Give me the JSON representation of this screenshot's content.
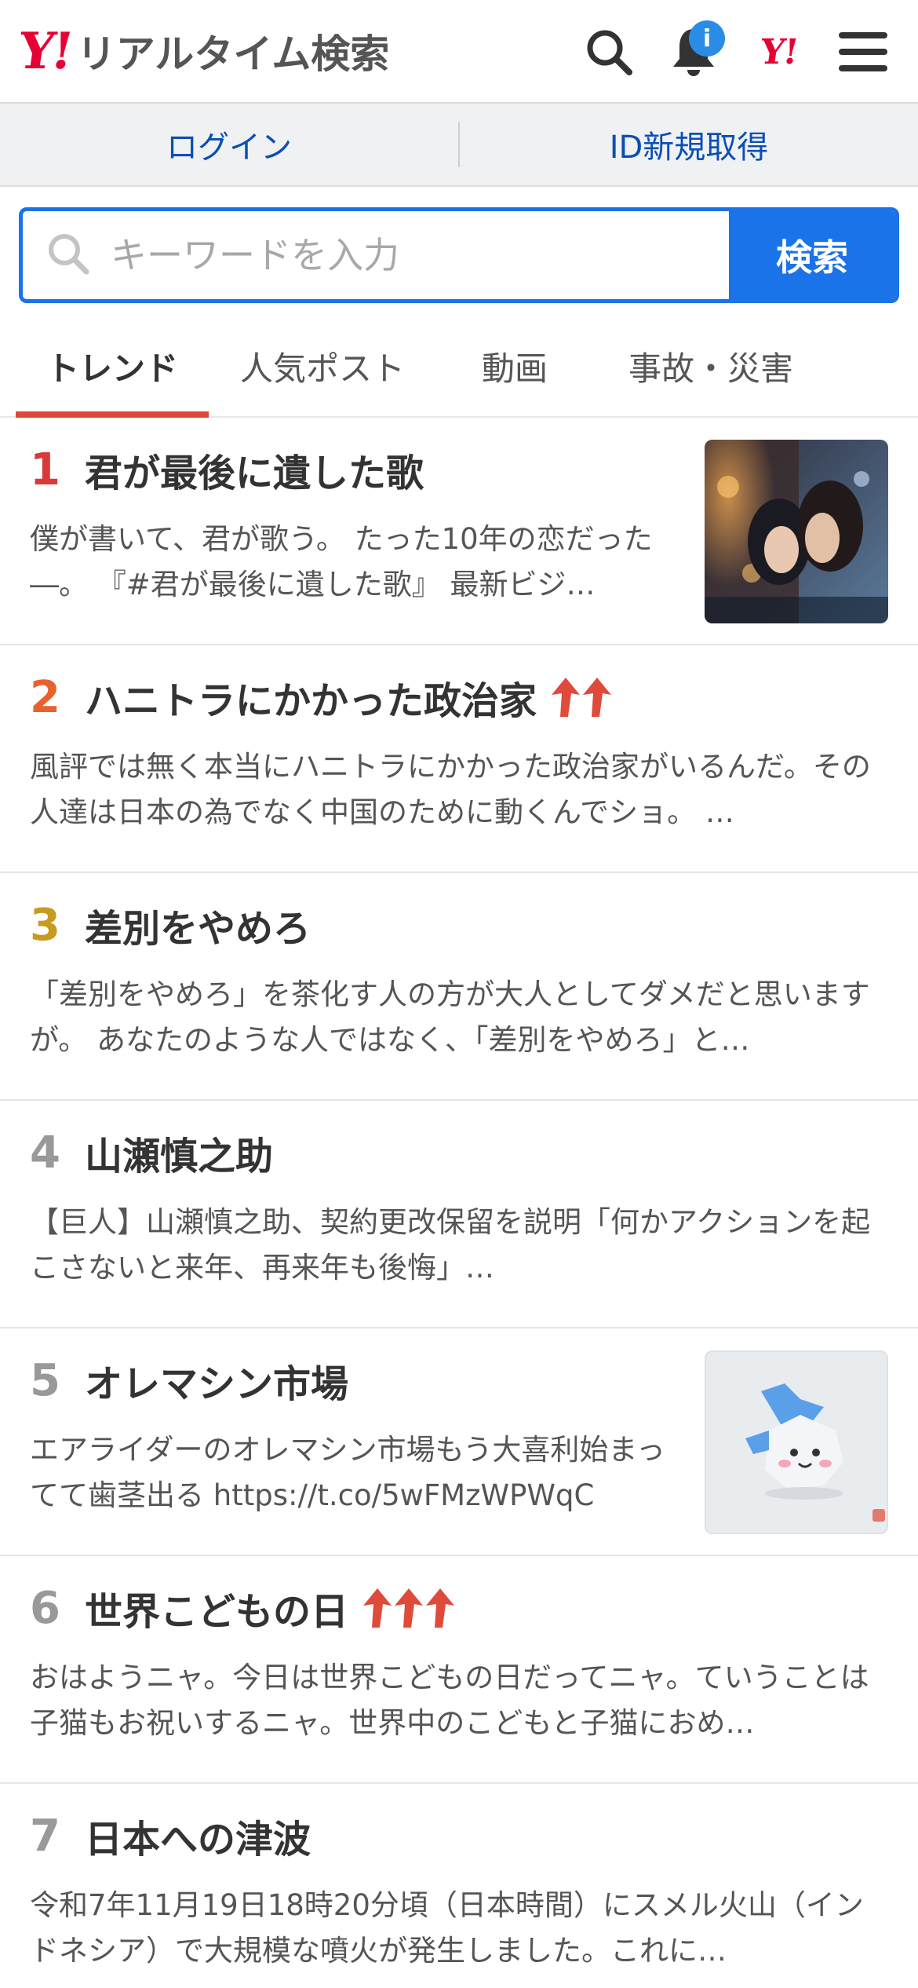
{
  "header": {
    "logo_text": "Y!",
    "service_name": "リアルタイム検索",
    "notification_badge": "i",
    "yahoo_small": "Y!"
  },
  "auth": {
    "login": "ログイン",
    "signup": "ID新規取得"
  },
  "search": {
    "placeholder": "キーワードを入力",
    "button": "検索"
  },
  "tabs": [
    {
      "label": "トレンド",
      "active": true
    },
    {
      "label": "人気ポスト",
      "active": false
    },
    {
      "label": "動画",
      "active": false
    },
    {
      "label": "事故・災害",
      "active": false
    }
  ],
  "colors": {
    "rank1": "#d83a3a",
    "rank2": "#e8622e",
    "rank3": "#c89a1e",
    "rank_other": "#999999",
    "accent": "#1a73e8",
    "tab_underline": "#e0463a"
  },
  "trends": [
    {
      "rank": "1",
      "title": "君が最後に遺した歌",
      "desc": "僕が書いて、君が歌う。 たった10年の恋だった―。 『#君が最後に遺した歌』 最新ビジ…",
      "arrows": 0,
      "thumb": "movie-poster"
    },
    {
      "rank": "2",
      "title": "ハニトラにかかった政治家",
      "desc": "風評では無く本当にハニトラにかかった政治家がいるんだ。その人達は日本の為でなく中国のために動くんでショ。 …",
      "arrows": 2,
      "thumb": null
    },
    {
      "rank": "3",
      "title": "差別をやめろ",
      "desc": "「差別をやめろ」を茶化す人の方が大人としてダメだと思いますが。 あなたのような人ではなく、「差別をやめろ」と…",
      "arrows": 0,
      "thumb": null
    },
    {
      "rank": "4",
      "title": "山瀬慎之助",
      "desc": "【巨人】山瀬慎之助、契約更改保留を説明「何かアクションを起こさないと来年、再来年も後悔」…",
      "arrows": 0,
      "thumb": null
    },
    {
      "rank": "5",
      "title": "オレマシン市場",
      "desc": "エアライダーのオレマシン市場もう大喜利始まってて歯茎出る https://t.co/5wFMzWPWqC",
      "arrows": 0,
      "thumb": "star-character"
    },
    {
      "rank": "6",
      "title": "世界こどもの日",
      "desc": "おはようニャ。今日は世界こどもの日だってニャ。ていうことは子猫もお祝いするニャ。世界中のこどもと子猫におめ…",
      "arrows": 3,
      "thumb": null
    },
    {
      "rank": "7",
      "title": "日本への津波",
      "desc": "令和7年11月19日18時20分頃（日本時間）にスメル火山（インドネシア）で大規模な噴火が発生しました。これに…",
      "arrows": 0,
      "thumb": null
    }
  ]
}
